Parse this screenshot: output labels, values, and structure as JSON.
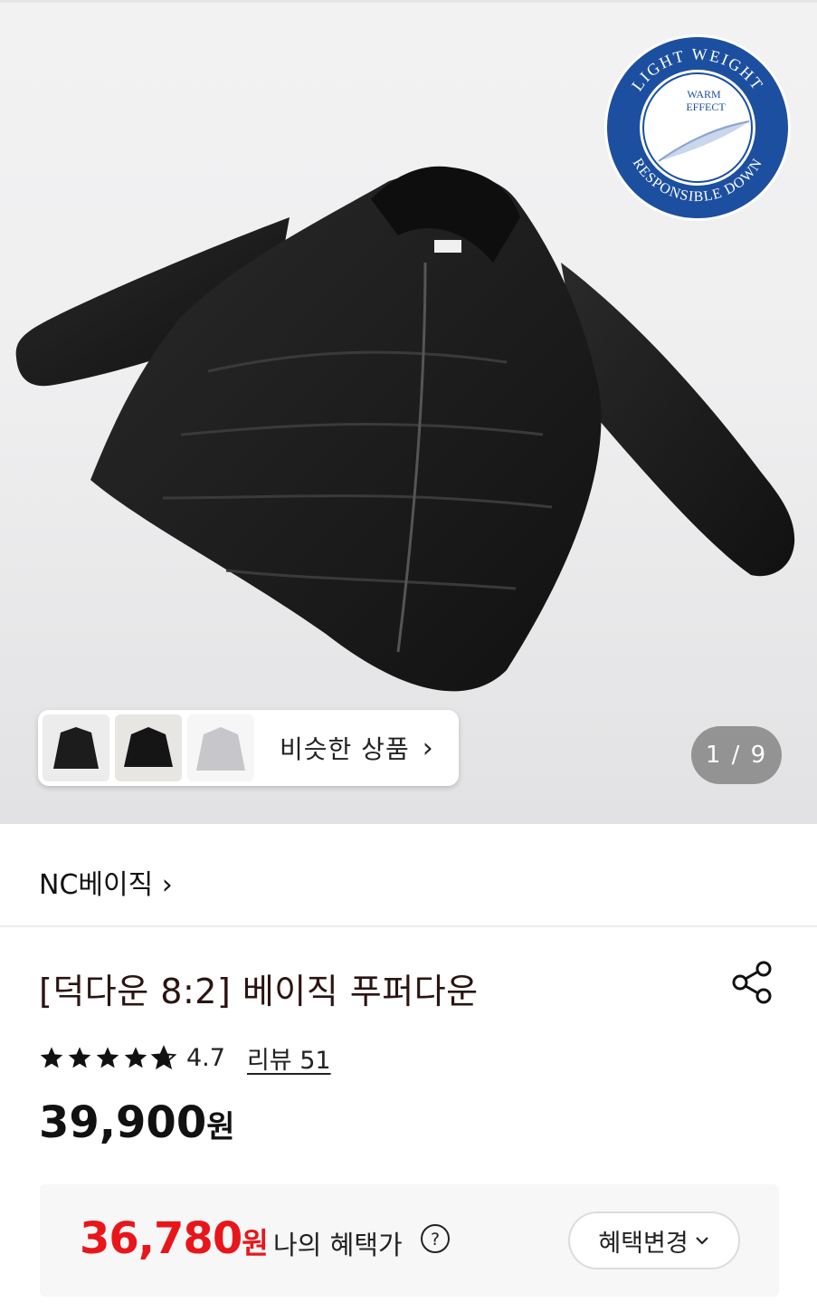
{
  "gallery": {
    "badge": {
      "top_text": "LIGHT WEIGHT",
      "bottom_text": "RESPONSIBLE DOWN",
      "center_line1": "WARM",
      "center_line2": "EFFECT"
    },
    "similar_label": "비슷한 상품",
    "counter": "1 / 9",
    "colors": {
      "badge_blue": "#1c4fa0",
      "jacket": "#1a1a1a"
    }
  },
  "brand": {
    "name": "NC베이직 ›"
  },
  "product": {
    "title": "[덕다운 8:2] 베이직 푸퍼다운",
    "rating": "4.7",
    "rating_stars": 4.7,
    "review_link": "리뷰 51",
    "price": "39,900",
    "price_unit": "원"
  },
  "benefit": {
    "price": "36,780",
    "price_unit": "원",
    "label": "나의 혜택가",
    "button_label": "혜택변경",
    "accent": "#e8161b"
  }
}
